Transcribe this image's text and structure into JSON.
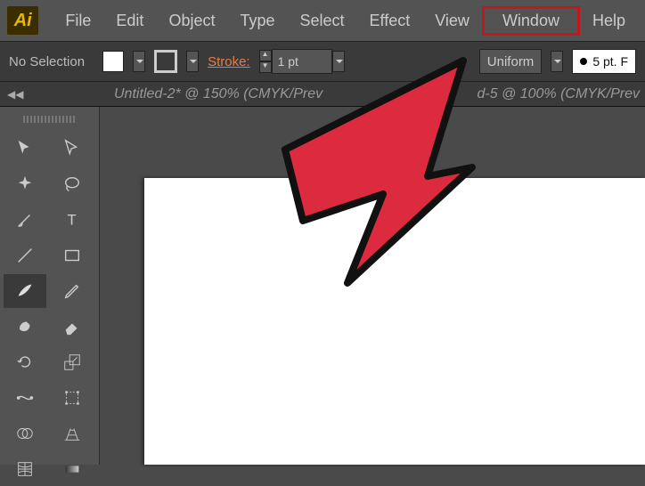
{
  "app": {
    "logo": "Ai"
  },
  "menu": {
    "file": "File",
    "edit": "Edit",
    "object": "Object",
    "type": "Type",
    "select": "Select",
    "effect": "Effect",
    "view": "View",
    "window": "Window",
    "help": "Help"
  },
  "options": {
    "selection": "No Selection",
    "stroke_label": "Stroke:",
    "stroke_value": "1 pt",
    "profile": "Uniform",
    "brush": "5 pt. F"
  },
  "tabs": {
    "doc1": "Untitled-2* @ 150% (CMYK/Prev",
    "doc2": "d-5 @ 100% (CMYK/Prev"
  }
}
